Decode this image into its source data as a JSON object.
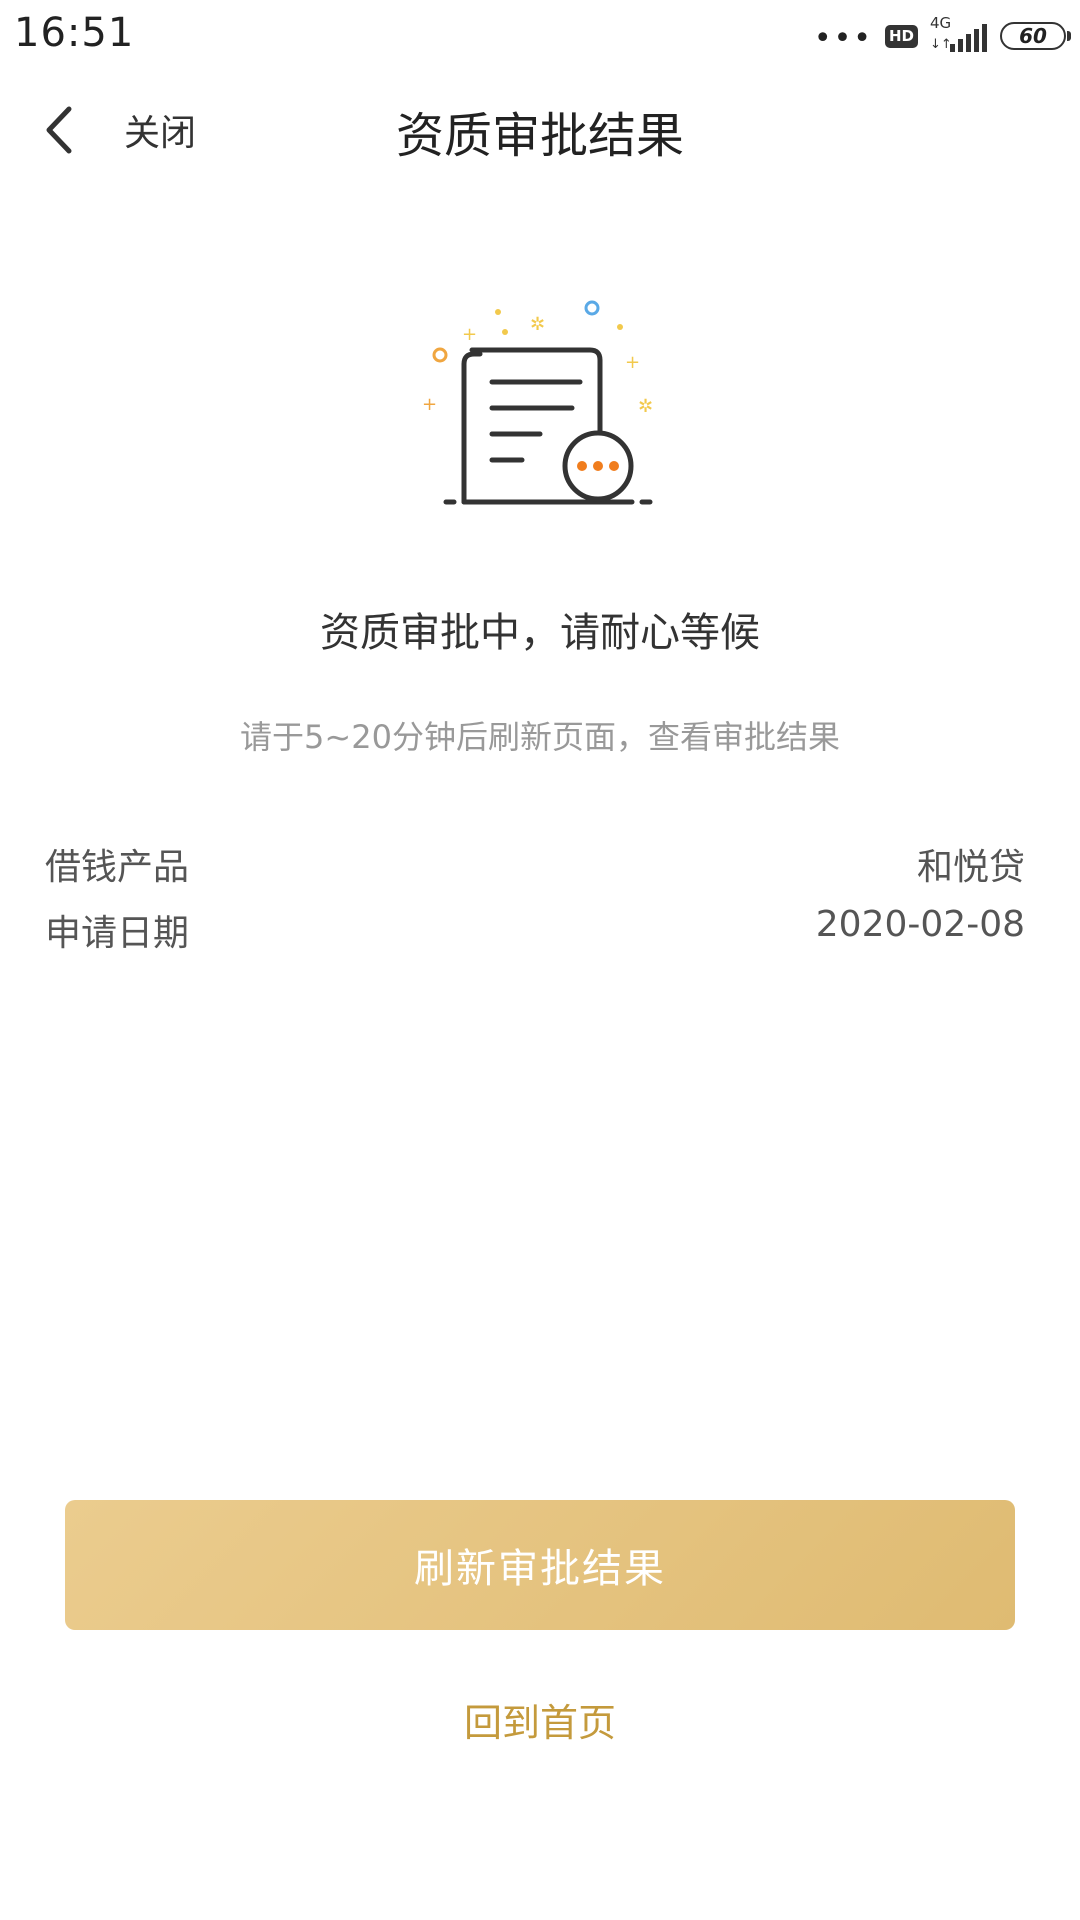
{
  "status_bar": {
    "time": "16:51",
    "dots": "•••",
    "hd_badge": "HD",
    "network": "4G",
    "network_arrows": "↓↑",
    "battery": "60"
  },
  "nav": {
    "close_label": "关闭",
    "title": "资质审批结果"
  },
  "status": {
    "title": "资质审批中，请耐心等候",
    "subtitle": "请于5~20分钟后刷新页面，查看审批结果"
  },
  "info": {
    "product_label": "借钱产品",
    "product_value": "和悦贷",
    "date_label": "申请日期",
    "date_value": "2020-02-08"
  },
  "actions": {
    "refresh_label": "刷新审批结果",
    "home_label": "回到首页"
  },
  "colors": {
    "accent_gold": "#dfbb72",
    "link_gold": "#c49a3c",
    "dots_orange": "#f07d1d",
    "sparkle_yellow": "#f2c94c",
    "sparkle_blue": "#5aa9e6"
  },
  "icons": [
    "back-chevron-icon",
    "signal-icon",
    "document-pending-icon"
  ]
}
